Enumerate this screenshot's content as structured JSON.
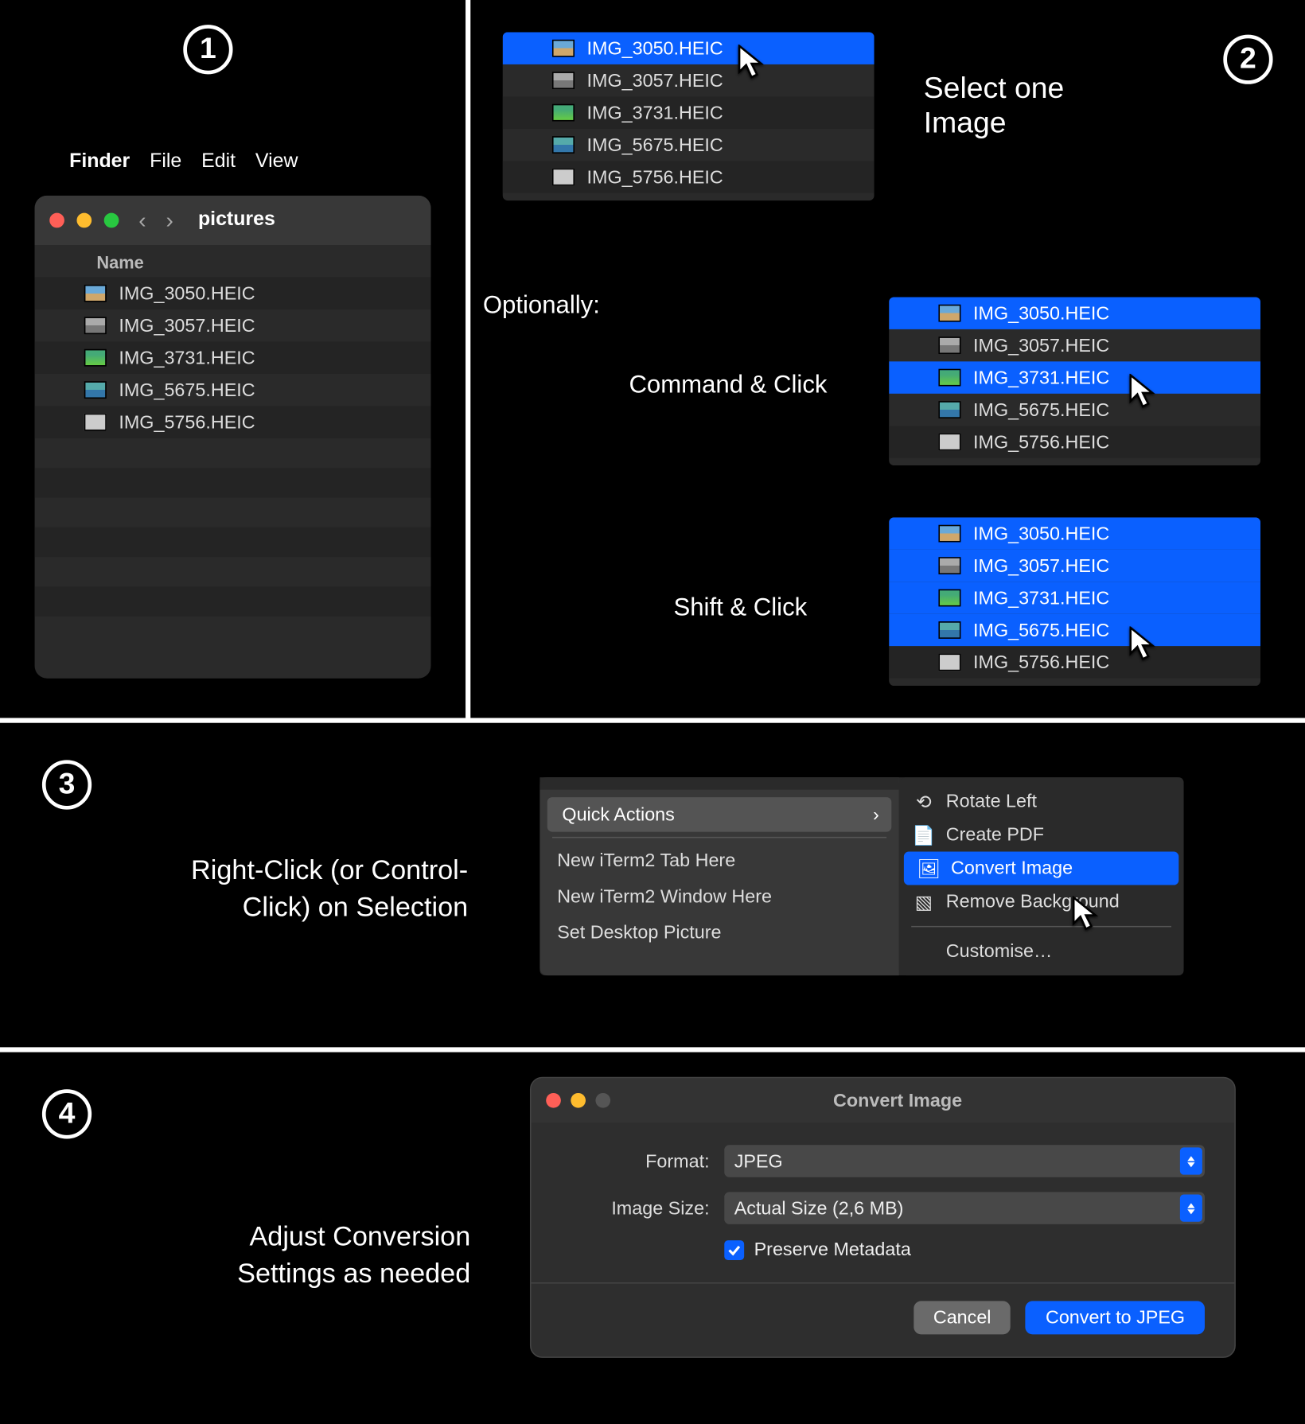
{
  "steps": {
    "s1": "1",
    "s2": "2",
    "s3": "3",
    "s4": "4"
  },
  "panel1": {
    "menu": {
      "finder": "Finder",
      "file": "File",
      "edit": "Edit",
      "view": "View"
    },
    "title": "pictures",
    "header_name": "Name",
    "files": [
      "IMG_3050.HEIC",
      "IMG_3057.HEIC",
      "IMG_3731.HEIC",
      "IMG_5675.HEIC",
      "IMG_5756.HEIC"
    ]
  },
  "panel2": {
    "caption_line1": "Select one",
    "caption_line2": "Image",
    "optionally": "Optionally:",
    "cmd_click": "Command & Click",
    "shift_click": "Shift & Click",
    "list_a": {
      "items": [
        "IMG_3050.HEIC",
        "IMG_3057.HEIC",
        "IMG_3731.HEIC",
        "IMG_5675.HEIC",
        "IMG_5756.HEIC"
      ],
      "selected": [
        0
      ]
    },
    "list_b": {
      "items": [
        "IMG_3050.HEIC",
        "IMG_3057.HEIC",
        "IMG_3731.HEIC",
        "IMG_5675.HEIC",
        "IMG_5756.HEIC"
      ],
      "selected": [
        0,
        2
      ]
    },
    "list_c": {
      "items": [
        "IMG_3050.HEIC",
        "IMG_3057.HEIC",
        "IMG_3731.HEIC",
        "IMG_5675.HEIC",
        "IMG_5756.HEIC"
      ],
      "selected": [
        0,
        1,
        2,
        3
      ]
    }
  },
  "panel3": {
    "caption_l1": "Right-Click (or Control-",
    "caption_l2": "Click) on Selection",
    "quick_actions": "Quick Actions",
    "left_items": [
      "New iTerm2 Tab Here",
      "New iTerm2 Window Here",
      "Set Desktop Picture"
    ],
    "right_items": [
      "Rotate Left",
      "Create PDF",
      "Convert Image",
      "Remove Background"
    ],
    "customise": "Customise…",
    "selected_index": 2
  },
  "panel4": {
    "caption_l1": "Adjust Conversion",
    "caption_l2": "Settings as needed",
    "title": "Convert Image",
    "format_label": "Format:",
    "format_value": "JPEG",
    "size_label": "Image Size:",
    "size_value": "Actual Size (2,6 MB)",
    "preserve": "Preserve Metadata",
    "cancel": "Cancel",
    "convert": "Convert to JPEG"
  }
}
